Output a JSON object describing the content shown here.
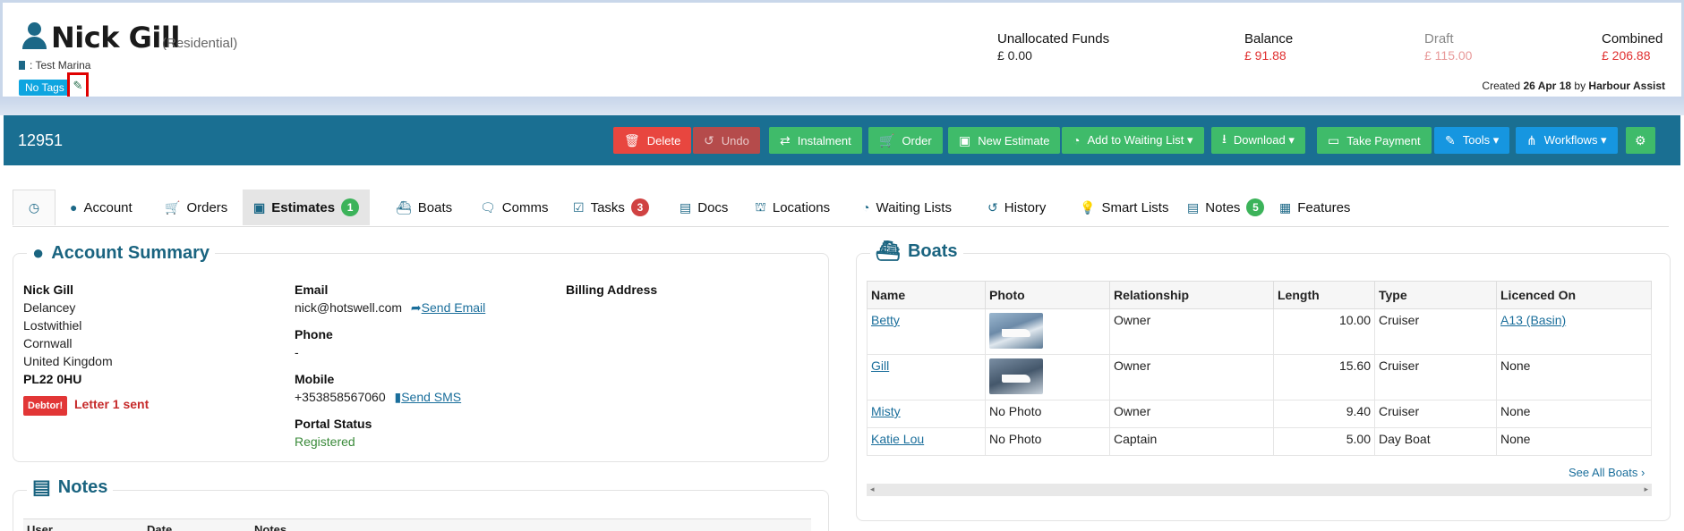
{
  "customer": {
    "name": "Nick Gill",
    "type": "(Residential)",
    "marina": ": Test Marina",
    "tag": "No Tags"
  },
  "funds": {
    "unallocated_label": "Unallocated Funds",
    "unallocated_value": "£ 0.00",
    "balance_label": "Balance",
    "balance_value": "£ 91.88",
    "draft_label": "Draft",
    "draft_value": "£ 115.00",
    "combined_label": "Combined",
    "combined_value": "£ 206.88"
  },
  "created": {
    "prefix": "Created",
    "date": "26 Apr 18",
    "by": "by",
    "user": "Harbour Assist"
  },
  "toolbar": {
    "record_id": "12951",
    "delete": "Delete",
    "undo": "Undo",
    "instalment": "Instalment",
    "order": "Order",
    "new_estimate": "New Estimate",
    "waiting_list": "Add to Waiting List ▾",
    "download": "Download ▾",
    "take_payment": "Take Payment",
    "tools": "Tools ▾",
    "workflows": "Workflows ▾"
  },
  "tabs": {
    "account": "Account",
    "orders": "Orders",
    "estimates": "Estimates",
    "estimates_count": "1",
    "boats": "Boats",
    "comms": "Comms",
    "tasks": "Tasks",
    "tasks_count": "3",
    "docs": "Docs",
    "locations": "Locations",
    "waiting_lists": "Waiting Lists",
    "history": "History",
    "smart_lists": "Smart Lists",
    "notes": "Notes",
    "notes_count": "5",
    "features": "Features"
  },
  "account_summary": {
    "title": "Account Summary",
    "address": [
      "Nick Gill",
      "Delancey",
      "Lostwithiel",
      "Cornwall",
      "United Kingdom",
      "PL22 0HU"
    ],
    "debtor_badge": "Debtor!",
    "letter_status": "Letter 1 sent",
    "email_label": "Email",
    "email": "nick@hotswell.com",
    "send_email": "Send Email",
    "phone_label": "Phone",
    "phone": "-",
    "mobile_label": "Mobile",
    "mobile": "+353858567060",
    "send_sms": "Send SMS",
    "portal_label": "Portal Status",
    "portal_value": "Registered",
    "billing_label": "Billing Address"
  },
  "notes_panel": {
    "title": "Notes",
    "columns": [
      "User",
      "Date",
      "Notes"
    ]
  },
  "boats": {
    "title": "Boats",
    "columns": [
      "Name",
      "Photo",
      "Relationship",
      "Length",
      "Type",
      "Licenced On"
    ],
    "rows": [
      {
        "name": "Betty",
        "photo": "",
        "relationship": "Owner",
        "length": "10.00",
        "type": "Cruiser",
        "licenced": "A13 (Basin)"
      },
      {
        "name": "Gill",
        "photo": "",
        "relationship": "Owner",
        "length": "15.60",
        "type": "Cruiser",
        "licenced": "None"
      },
      {
        "name": "Misty",
        "photo": "No Photo",
        "relationship": "Owner",
        "length": "9.40",
        "type": "Cruiser",
        "licenced": "None"
      },
      {
        "name": "Katie Lou",
        "photo": "No Photo",
        "relationship": "Captain",
        "length": "5.00",
        "type": "Day Boat",
        "licenced": "None"
      }
    ],
    "see_all": "See All Boats ›"
  }
}
